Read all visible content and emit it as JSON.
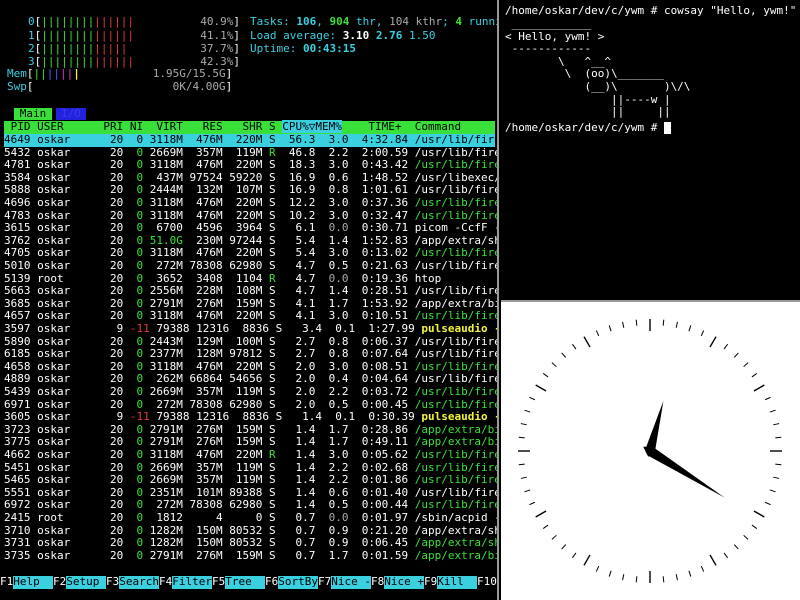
{
  "htop": {
    "cpus": [
      {
        "num": "0",
        "pct": "40.9%",
        "bars": "||||||||||||||"
      },
      {
        "num": "1",
        "pct": "41.1%",
        "bars": "||||||||||||||"
      },
      {
        "num": "2",
        "pct": "37.7%",
        "bars": "|||||||||||||"
      },
      {
        "num": "3",
        "pct": "42.3%",
        "bars": "||||||||||||||"
      }
    ],
    "mem": {
      "label": "Mem",
      "value": "1.95G/15.5G",
      "bars": "|||||||"
    },
    "swp": {
      "label": "Swp",
      "value": "0K/4.00G"
    },
    "tasks": {
      "label": "Tasks: ",
      "count": "106",
      "sep1": ", ",
      "thr": "904",
      "thr_label": " thr, ",
      "kthr": "104 kthr",
      "sep2": "; ",
      "running": "4",
      "running_label": " runnin"
    },
    "load": {
      "label": "Load average: ",
      "l1": "3.10",
      "l5": "2.76",
      "l15": "1.50"
    },
    "uptime": {
      "label": "Uptime: ",
      "value": "00:43:15"
    },
    "tabs": {
      "main": "Main",
      "io": "I/O"
    },
    "header": {
      "pid": "PID",
      "user": "USER",
      "pri": "PRI",
      "ni": "NI",
      "virt": "VIRT",
      "res": "RES",
      "shr": "SHR",
      "s": "S",
      "cpu": "CPU%▽MEM%",
      "time": "TIME+",
      "cmd": "Command"
    },
    "processes": [
      {
        "pid": "4649",
        "user": "oskar",
        "pri": "20",
        "ni": "0",
        "virt": "3118M",
        "res": "476M",
        "shr": "220M",
        "s": "S",
        "cpu": "56.3",
        "mem": "3.0",
        "time": "4:32.84",
        "cmd": "/usr/lib/firefox/",
        "thread": true
      },
      {
        "pid": "5432",
        "user": "oskar",
        "pri": "20",
        "ni": "0",
        "virt": "2669M",
        "res": "357M",
        "shr": "119M",
        "s": "R",
        "cpu": "46.8",
        "mem": "2.2",
        "time": "2:00.59",
        "cmd": "/usr/lib/firefox/",
        "thread": false
      },
      {
        "pid": "4781",
        "user": "oskar",
        "pri": "20",
        "ni": "0",
        "virt": "3118M",
        "res": "476M",
        "shr": "220M",
        "s": "S",
        "cpu": "18.3",
        "mem": "3.0",
        "time": "0:43.42",
        "cmd": "/usr/lib/firefox/",
        "thread": true
      },
      {
        "pid": "3584",
        "user": "oskar",
        "pri": "20",
        "ni": "0",
        "virt": "437M",
        "res": "97524",
        "shr": "59220",
        "s": "S",
        "cpu": "16.9",
        "mem": "0.6",
        "time": "1:48.52",
        "cmd": "/usr/libexec/Xorg",
        "thread": false
      },
      {
        "pid": "5888",
        "user": "oskar",
        "pri": "20",
        "ni": "0",
        "virt": "2444M",
        "res": "132M",
        "shr": "107M",
        "s": "S",
        "cpu": "16.9",
        "mem": "0.8",
        "time": "1:01.61",
        "cmd": "/usr/lib/firefox/",
        "thread": false
      },
      {
        "pid": "4696",
        "user": "oskar",
        "pri": "20",
        "ni": "0",
        "virt": "3118M",
        "res": "476M",
        "shr": "220M",
        "s": "S",
        "cpu": "12.2",
        "mem": "3.0",
        "time": "0:37.36",
        "cmd": "/usr/lib/firefox/",
        "thread": true
      },
      {
        "pid": "4783",
        "user": "oskar",
        "pri": "20",
        "ni": "0",
        "virt": "3118M",
        "res": "476M",
        "shr": "220M",
        "s": "S",
        "cpu": "10.2",
        "mem": "3.0",
        "time": "0:32.47",
        "cmd": "/usr/lib/firefox/",
        "thread": true
      },
      {
        "pid": "3615",
        "user": "oskar",
        "pri": "20",
        "ni": "0",
        "virt": "6700",
        "res": "4596",
        "shr": "3964",
        "s": "S",
        "cpu": "6.1",
        "mem": "0.0",
        "time": "0:30.71",
        "cmd": "picom -CcfF -D3",
        "thread": false
      },
      {
        "pid": "3762",
        "user": "oskar",
        "pri": "20",
        "ni": "0",
        "virt": "51.0G",
        "res": "230M",
        "shr": "97244",
        "s": "S",
        "cpu": "5.4",
        "mem": "1.4",
        "time": "1:52.83",
        "cmd": "/app/extra/share/",
        "thread": false
      },
      {
        "pid": "4705",
        "user": "oskar",
        "pri": "20",
        "ni": "0",
        "virt": "3118M",
        "res": "476M",
        "shr": "220M",
        "s": "S",
        "cpu": "5.4",
        "mem": "3.0",
        "time": "0:13.02",
        "cmd": "/usr/lib/firefox/",
        "thread": true
      },
      {
        "pid": "5010",
        "user": "oskar",
        "pri": "20",
        "ni": "0",
        "virt": "272M",
        "res": "78308",
        "shr": "62980",
        "s": "S",
        "cpu": "4.7",
        "mem": "0.5",
        "time": "0:21.63",
        "cmd": "/usr/lib/firefox/",
        "thread": false
      },
      {
        "pid": "5139",
        "user": "root",
        "pri": "20",
        "ni": "0",
        "virt": "3652",
        "res": "3408",
        "shr": "1104",
        "s": "R",
        "cpu": "4.7",
        "mem": "0.0",
        "time": "0:19.36",
        "cmd": "htop",
        "thread": false
      },
      {
        "pid": "5663",
        "user": "oskar",
        "pri": "20",
        "ni": "0",
        "virt": "2556M",
        "res": "228M",
        "shr": "108M",
        "s": "S",
        "cpu": "4.7",
        "mem": "1.4",
        "time": "0:28.51",
        "cmd": "/usr/lib/firefox/",
        "thread": false
      },
      {
        "pid": "3685",
        "user": "oskar",
        "pri": "20",
        "ni": "0",
        "virt": "2791M",
        "res": "276M",
        "shr": "159M",
        "s": "S",
        "cpu": "4.1",
        "mem": "1.7",
        "time": "1:53.92",
        "cmd": "/app/extra/bin/sp",
        "thread": false
      },
      {
        "pid": "4657",
        "user": "oskar",
        "pri": "20",
        "ni": "0",
        "virt": "3118M",
        "res": "476M",
        "shr": "220M",
        "s": "S",
        "cpu": "4.1",
        "mem": "3.0",
        "time": "0:10.51",
        "cmd": "/usr/lib/firefox/",
        "thread": true
      },
      {
        "pid": "3597",
        "user": "oskar",
        "pri": "9",
        "ni": "-11",
        "virt": "79388",
        "res": "12316",
        "shr": "8836",
        "s": "S",
        "cpu": "3.4",
        "mem": "0.1",
        "time": "1:27.99",
        "cmd": "pulseaudio --star",
        "thread": false,
        "hl": "y"
      },
      {
        "pid": "5890",
        "user": "oskar",
        "pri": "20",
        "ni": "0",
        "virt": "2443M",
        "res": "129M",
        "shr": "100M",
        "s": "S",
        "cpu": "2.7",
        "mem": "0.8",
        "time": "0:06.37",
        "cmd": "/usr/lib/firefox/",
        "thread": false
      },
      {
        "pid": "6185",
        "user": "oskar",
        "pri": "20",
        "ni": "0",
        "virt": "2377M",
        "res": "128M",
        "shr": "97812",
        "s": "S",
        "cpu": "2.7",
        "mem": "0.8",
        "time": "0:07.64",
        "cmd": "/usr/lib/firefox/",
        "thread": false
      },
      {
        "pid": "4658",
        "user": "oskar",
        "pri": "20",
        "ni": "0",
        "virt": "3118M",
        "res": "476M",
        "shr": "220M",
        "s": "S",
        "cpu": "2.0",
        "mem": "3.0",
        "time": "0:08.51",
        "cmd": "/usr/lib/firefox/",
        "thread": true
      },
      {
        "pid": "4889",
        "user": "oskar",
        "pri": "20",
        "ni": "0",
        "virt": "262M",
        "res": "66864",
        "shr": "54656",
        "s": "S",
        "cpu": "2.0",
        "mem": "0.4",
        "time": "0:04.64",
        "cmd": "/usr/lib/firefox/",
        "thread": false
      },
      {
        "pid": "5439",
        "user": "oskar",
        "pri": "20",
        "ni": "0",
        "virt": "2669M",
        "res": "357M",
        "shr": "119M",
        "s": "S",
        "cpu": "2.0",
        "mem": "2.2",
        "time": "0:03.72",
        "cmd": "/usr/lib/firefox/",
        "thread": true
      },
      {
        "pid": "6971",
        "user": "oskar",
        "pri": "20",
        "ni": "0",
        "virt": "272M",
        "res": "78308",
        "shr": "62980",
        "s": "S",
        "cpu": "2.0",
        "mem": "0.5",
        "time": "0:00.45",
        "cmd": "/usr/lib/firefox/",
        "thread": true
      },
      {
        "pid": "3605",
        "user": "oskar",
        "pri": "9",
        "ni": "-11",
        "virt": "79388",
        "res": "12316",
        "shr": "8836",
        "s": "S",
        "cpu": "1.4",
        "mem": "0.1",
        "time": "0:30.39",
        "cmd": "pulseaudio --star",
        "thread": true,
        "hl": "y"
      },
      {
        "pid": "3723",
        "user": "oskar",
        "pri": "20",
        "ni": "0",
        "virt": "2791M",
        "res": "276M",
        "shr": "159M",
        "s": "S",
        "cpu": "1.4",
        "mem": "1.7",
        "time": "0:28.86",
        "cmd": "/app/extra/bin/sp",
        "thread": true
      },
      {
        "pid": "3775",
        "user": "oskar",
        "pri": "20",
        "ni": "0",
        "virt": "2791M",
        "res": "276M",
        "shr": "159M",
        "s": "S",
        "cpu": "1.4",
        "mem": "1.7",
        "time": "0:49.11",
        "cmd": "/app/extra/bin/sp",
        "thread": true
      },
      {
        "pid": "4662",
        "user": "oskar",
        "pri": "20",
        "ni": "0",
        "virt": "3118M",
        "res": "476M",
        "shr": "220M",
        "s": "R",
        "cpu": "1.4",
        "mem": "3.0",
        "time": "0:05.62",
        "cmd": "/usr/lib/firefox/",
        "thread": true
      },
      {
        "pid": "5451",
        "user": "oskar",
        "pri": "20",
        "ni": "0",
        "virt": "2669M",
        "res": "357M",
        "shr": "119M",
        "s": "S",
        "cpu": "1.4",
        "mem": "2.2",
        "time": "0:02.68",
        "cmd": "/usr/lib/firefox/",
        "thread": true
      },
      {
        "pid": "5465",
        "user": "oskar",
        "pri": "20",
        "ni": "0",
        "virt": "2669M",
        "res": "357M",
        "shr": "119M",
        "s": "S",
        "cpu": "1.4",
        "mem": "2.2",
        "time": "0:01.86",
        "cmd": "/usr/lib/firefox/",
        "thread": true
      },
      {
        "pid": "5551",
        "user": "oskar",
        "pri": "20",
        "ni": "0",
        "virt": "2351M",
        "res": "101M",
        "shr": "89388",
        "s": "S",
        "cpu": "1.4",
        "mem": "0.6",
        "time": "0:01.40",
        "cmd": "/usr/lib/firefox/",
        "thread": false
      },
      {
        "pid": "6972",
        "user": "oskar",
        "pri": "20",
        "ni": "0",
        "virt": "272M",
        "res": "78308",
        "shr": "62980",
        "s": "S",
        "cpu": "1.4",
        "mem": "0.5",
        "time": "0:00.44",
        "cmd": "/usr/lib/firefox/",
        "thread": true
      },
      {
        "pid": "2415",
        "user": "root",
        "pri": "20",
        "ni": "0",
        "virt": "1812",
        "res": "4",
        "shr": "0",
        "s": "S",
        "cpu": "0.7",
        "mem": "0.0",
        "time": "0:01.97",
        "cmd": "/sbin/acpid -f",
        "thread": false
      },
      {
        "pid": "3710",
        "user": "oskar",
        "pri": "20",
        "ni": "0",
        "virt": "1282M",
        "res": "150M",
        "shr": "80532",
        "s": "S",
        "cpu": "0.7",
        "mem": "0.9",
        "time": "0:21.20",
        "cmd": "/app/extra/share/",
        "thread": false
      },
      {
        "pid": "3731",
        "user": "oskar",
        "pri": "20",
        "ni": "0",
        "virt": "1282M",
        "res": "150M",
        "shr": "80532",
        "s": "S",
        "cpu": "0.7",
        "mem": "0.9",
        "time": "0:06.45",
        "cmd": "/app/extra/share/",
        "thread": true
      },
      {
        "pid": "3735",
        "user": "oskar",
        "pri": "20",
        "ni": "0",
        "virt": "2791M",
        "res": "276M",
        "shr": "159M",
        "s": "S",
        "cpu": "0.7",
        "mem": "1.7",
        "time": "0:01.59",
        "cmd": "/app/extra/bin/sp",
        "thread": true
      }
    ],
    "fkeys": [
      {
        "key": "F1",
        "label": "Help  "
      },
      {
        "key": "F2",
        "label": "Setup "
      },
      {
        "key": "F3",
        "label": "Search"
      },
      {
        "key": "F4",
        "label": "Filter"
      },
      {
        "key": "F5",
        "label": "Tree  "
      },
      {
        "key": "F6",
        "label": "SortBy"
      },
      {
        "key": "F7",
        "label": "Nice -"
      },
      {
        "key": "F8",
        "label": "Nice +"
      },
      {
        "key": "F9",
        "label": "Kill  "
      },
      {
        "key": "F10",
        "label": "Quit  "
      }
    ]
  },
  "terminal": {
    "prompt1": "/home/oskar/dev/c/ywm # cowsay \"Hello, ywm!\"",
    "cow": [
      " ____________",
      "< Hello, ywm! >",
      " ------------",
      "        \\   ^__^",
      "         \\  (oo)\\_______",
      "            (__)\\       )\\/\\",
      "                ||----w |",
      "                ||     ||"
    ],
    "prompt2": "/home/oskar/dev/c/ywm # "
  },
  "clock": {
    "hour_angle": 15,
    "minute_angle": 122
  }
}
